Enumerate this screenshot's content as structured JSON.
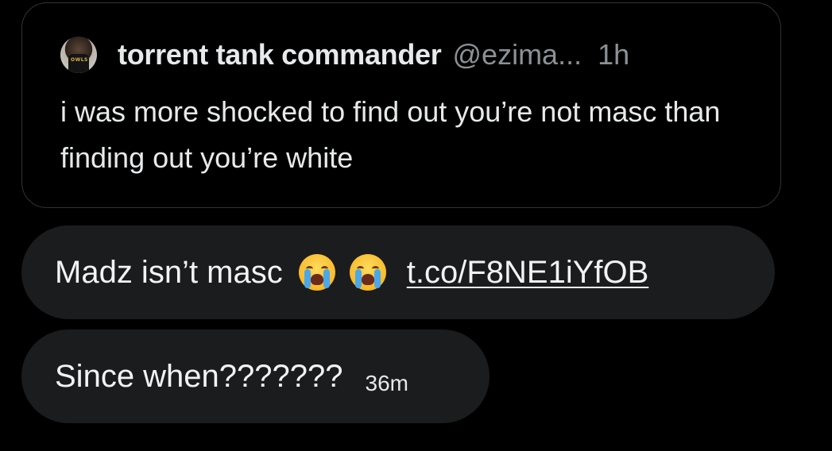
{
  "quote": {
    "display_name": "torrent tank commander",
    "handle": "@ezima...",
    "time": "1h",
    "avatar_jersey_text": "OWLS",
    "text": "i was more shocked to find out you’re not masc than finding out you’re white"
  },
  "messages": [
    {
      "text": "Madz isn’t masc",
      "emojis": [
        "loudly-crying-face",
        "loudly-crying-face"
      ],
      "link": "t.co/F8NE1iYfOB"
    },
    {
      "text": "Since when???????",
      "time": "36m"
    }
  ],
  "colors": {
    "background": "#000000",
    "bubble": "#1b1c1e",
    "card_border": "#2f3336",
    "secondary_text": "#8b9196",
    "primary_text": "#e7e9ea"
  }
}
